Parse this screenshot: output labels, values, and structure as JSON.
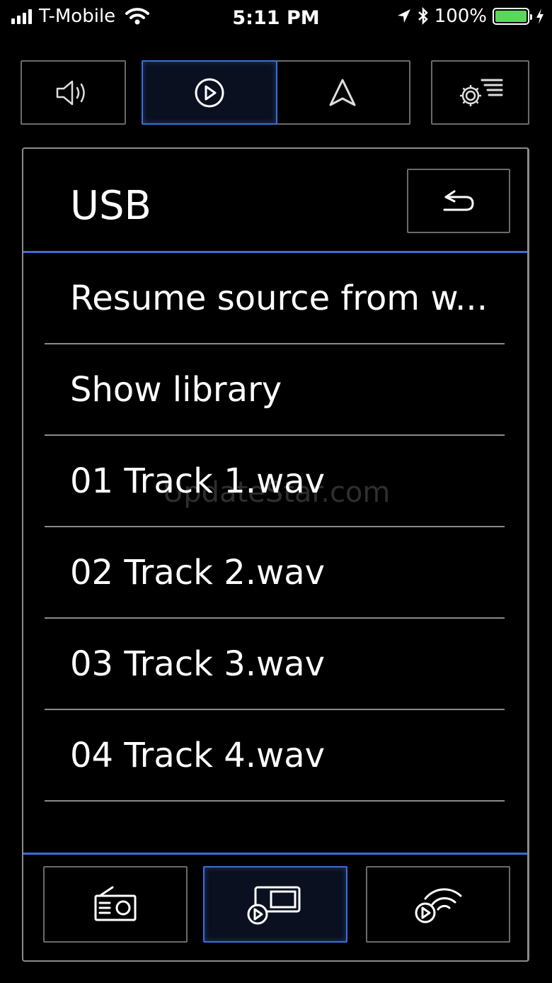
{
  "status_bar": {
    "carrier": "T-Mobile",
    "time": "5:11 PM",
    "battery_percent": "100%",
    "battery_level": 1.0,
    "battery_color": "#5bd65b"
  },
  "toolbar": {
    "buttons": [
      {
        "name": "volume",
        "icon": "speaker-icon",
        "active": false
      },
      {
        "name": "media",
        "icon": "play-circle-icon",
        "active": true
      },
      {
        "name": "navigation",
        "icon": "navigation-arrow-icon",
        "active": false
      },
      {
        "name": "settings",
        "icon": "settings-menu-icon",
        "active": false
      }
    ]
  },
  "panel": {
    "title": "USB",
    "back_icon": "back-arrow-icon",
    "items": [
      {
        "label": "Resume source from w..."
      },
      {
        "label": "Show library"
      },
      {
        "label": "01 Track 1.wav"
      },
      {
        "label": "02 Track 2.wav"
      },
      {
        "label": "03 Track 3.wav"
      },
      {
        "label": "04 Track 4.wav"
      }
    ],
    "watermark": "UpdateStar.com"
  },
  "bottom_tabs": [
    {
      "name": "radio",
      "icon": "radio-icon",
      "active": false
    },
    {
      "name": "media-source",
      "icon": "media-player-icon",
      "active": true
    },
    {
      "name": "streaming",
      "icon": "wireless-play-icon",
      "active": false
    }
  ],
  "colors": {
    "accent": "#3b6ed8",
    "background": "#000000",
    "border": "#8a8a8a"
  }
}
